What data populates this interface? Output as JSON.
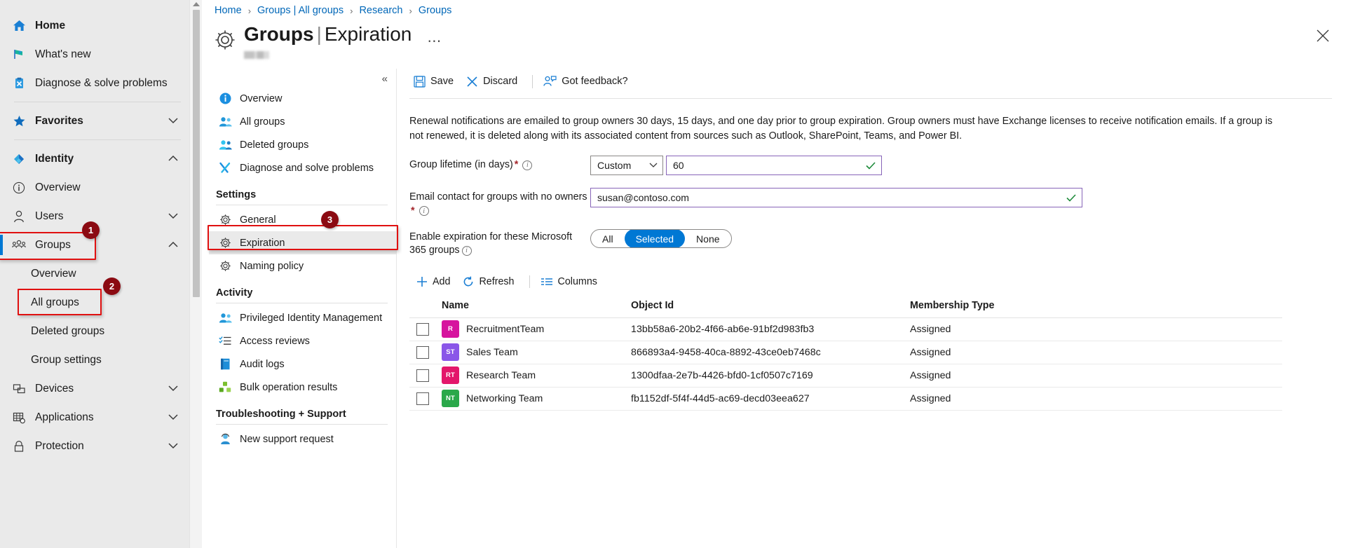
{
  "global_nav": {
    "items": [
      {
        "label": "Home",
        "icon": "home-icon",
        "bold": true,
        "kind": "item"
      },
      {
        "label": "What's new",
        "icon": "megaphone-icon",
        "bold": false,
        "kind": "item"
      },
      {
        "label": "Diagnose & solve problems",
        "icon": "diagnose-icon",
        "bold": false,
        "kind": "item"
      },
      {
        "kind": "divider"
      },
      {
        "label": "Favorites",
        "icon": "star-icon",
        "bold": true,
        "kind": "item",
        "chevron": "down"
      },
      {
        "kind": "divider"
      },
      {
        "label": "Identity",
        "icon": "identity-icon",
        "bold": true,
        "kind": "item",
        "chevron": "up"
      },
      {
        "label": "Overview",
        "icon": "info-circle-icon",
        "bold": false,
        "kind": "item"
      },
      {
        "label": "Users",
        "icon": "user-icon",
        "bold": false,
        "kind": "item",
        "chevron": "down"
      },
      {
        "label": "Groups",
        "icon": "groups-icon",
        "bold": false,
        "kind": "item",
        "chevron": "up",
        "selected": true
      },
      {
        "label": "Overview",
        "kind": "sub"
      },
      {
        "label": "All groups",
        "kind": "sub"
      },
      {
        "label": "Deleted groups",
        "kind": "sub"
      },
      {
        "label": "Group settings",
        "kind": "sub"
      },
      {
        "label": "Devices",
        "icon": "devices-icon",
        "bold": false,
        "kind": "item",
        "chevron": "down"
      },
      {
        "label": "Applications",
        "icon": "applications-icon",
        "bold": false,
        "kind": "item",
        "chevron": "down"
      },
      {
        "label": "Protection",
        "icon": "protection-icon",
        "bold": false,
        "kind": "item",
        "chevron": "down"
      }
    ]
  },
  "annotations": [
    {
      "number": "1",
      "target": "groups-nav-item"
    },
    {
      "number": "2",
      "target": "all-groups-nav-item"
    },
    {
      "number": "3",
      "target": "expiration-blade-item"
    }
  ],
  "breadcrumb": {
    "items": [
      "Home",
      "Groups | All groups",
      "Research",
      "Groups"
    ],
    "separator": "›"
  },
  "header": {
    "title_main": "Groups",
    "title_divider": "|",
    "title_sub": "Expiration",
    "ellipsis": "⋯",
    "gear_icon": "gear-icon",
    "close_icon": "close-icon"
  },
  "blade_menu": {
    "collapse_icon": "«",
    "items": [
      {
        "label": "Overview",
        "icon": "info-blue-icon",
        "kind": "item"
      },
      {
        "label": "All groups",
        "icon": "groups-blue-icon",
        "kind": "item"
      },
      {
        "label": "Deleted groups",
        "icon": "deleted-groups-icon",
        "kind": "item"
      },
      {
        "label": "Diagnose and solve problems",
        "icon": "tools-icon",
        "kind": "item"
      },
      {
        "label": "Settings",
        "kind": "section"
      },
      {
        "label": "General",
        "icon": "gear-icon",
        "kind": "item"
      },
      {
        "label": "Expiration",
        "icon": "gear-icon",
        "kind": "item",
        "active": true
      },
      {
        "label": "Naming policy",
        "icon": "gear-icon",
        "kind": "item"
      },
      {
        "label": "Activity",
        "kind": "section"
      },
      {
        "label": "Privileged Identity Management",
        "icon": "pim-icon",
        "kind": "item"
      },
      {
        "label": "Access reviews",
        "icon": "checklist-icon",
        "kind": "item"
      },
      {
        "label": "Audit logs",
        "icon": "book-icon",
        "kind": "item"
      },
      {
        "label": "Bulk operation results",
        "icon": "bulk-icon",
        "kind": "item"
      },
      {
        "label": "Troubleshooting + Support",
        "kind": "section"
      },
      {
        "label": "New support request",
        "icon": "support-icon",
        "kind": "item"
      }
    ]
  },
  "command_bar": {
    "save_label": "Save",
    "discard_label": "Discard",
    "feedback_label": "Got feedback?"
  },
  "main": {
    "description": "Renewal notifications are emailed to group owners 30 days, 15 days, and one day prior to group expiration. Group owners must have Exchange licenses to receive notification emails. If a group is not renewed, it is deleted along with its associated content from sources such as Outlook, SharePoint, Teams, and Power BI.",
    "group_lifetime": {
      "label": "Group lifetime (in days)",
      "required": true,
      "select_value": "Custom",
      "input_value": "60",
      "valid": true
    },
    "email_contact": {
      "label": "Email contact for groups with no owners",
      "required": true,
      "input_value": "susan@contoso.com",
      "valid": true
    },
    "enable_expiration": {
      "label": "Enable expiration for these Microsoft 365 groups",
      "options": [
        "All",
        "Selected",
        "None"
      ],
      "selected": "Selected"
    },
    "table_toolbar": {
      "add_label": "Add",
      "refresh_label": "Refresh",
      "columns_label": "Columns"
    },
    "table": {
      "columns": [
        "Name",
        "Object Id",
        "Membership Type"
      ],
      "rows": [
        {
          "checked": false,
          "initials": "R",
          "avatar_color": "#d6149e",
          "name": "RecruitmentTeam",
          "object_id": "13bb58a6-20b2-4f66-ab6e-91bf2d983fb3",
          "membership_type": "Assigned"
        },
        {
          "checked": false,
          "initials": "ST",
          "avatar_color": "#8a56e8",
          "name": "Sales Team",
          "object_id": "866893a4-9458-40ca-8892-43ce0eb7468c",
          "membership_type": "Assigned"
        },
        {
          "checked": false,
          "initials": "RT",
          "avatar_color": "#e3176b",
          "name": "Research Team",
          "object_id": "1300dfaa-2e7b-4426-bfd0-1cf0507c7169",
          "membership_type": "Assigned"
        },
        {
          "checked": false,
          "initials": "NT",
          "avatar_color": "#2aa84a",
          "name": "Networking Team",
          "object_id": "fb1152df-5f4f-44d5-ac69-decd03eea627",
          "membership_type": "Assigned"
        }
      ]
    }
  },
  "colors": {
    "accent": "#0078d4",
    "link": "#0067b8",
    "annotation": "#e01010",
    "annotation_badge": "#8b0a12",
    "required": "#a4262c",
    "valid_tick": "#1d8a3a",
    "field_focus_border": "#8764b8"
  }
}
